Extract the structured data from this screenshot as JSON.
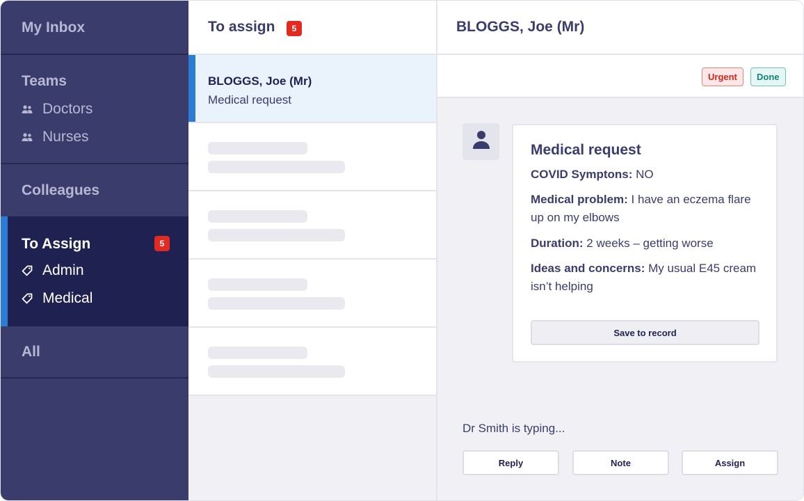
{
  "sidebar": {
    "my_inbox": "My Inbox",
    "teams": {
      "title": "Teams",
      "items": [
        {
          "label": "Doctors",
          "icon": "people-icon"
        },
        {
          "label": "Nurses",
          "icon": "people-icon"
        }
      ]
    },
    "colleagues": "Colleagues",
    "to_assign": {
      "title": "To Assign",
      "count": "5",
      "items": [
        {
          "label": "Admin",
          "icon": "tag-icon"
        },
        {
          "label": "Medical",
          "icon": "tag-icon"
        }
      ]
    },
    "all": "All"
  },
  "list": {
    "title": "To assign",
    "count": "5",
    "rows": [
      {
        "name": "BLOGGS, Joe (Mr)",
        "subject": "Medical request",
        "selected": true
      }
    ]
  },
  "detail": {
    "patient": "BLOGGS, Joe (Mr)",
    "tags": {
      "urgent": "Urgent",
      "done": "Done"
    },
    "card": {
      "title": "Medical request",
      "fields": [
        {
          "label": "COVID Symptons:",
          "value": "NO"
        },
        {
          "label": "Medical problem:",
          "value": "I have an eczema flare up on my elbows"
        },
        {
          "label": "Duration:",
          "value": "2 weeks – getting worse"
        },
        {
          "label": "Ideas and concerns:",
          "value": "My usual E45 cream isn’t helping"
        }
      ],
      "save_label": "Save to record"
    },
    "typing_status": "Dr Smith is typing...",
    "actions": {
      "reply": "Reply",
      "note": "Note",
      "assign": "Assign"
    }
  },
  "colors": {
    "sidebar_bg": "#3a3c6c",
    "sidebar_active_bg": "#1f2150",
    "accent": "#2a7cd4",
    "badge": "#e02a22",
    "urgent": "#d4261d",
    "done": "#0f8676"
  }
}
